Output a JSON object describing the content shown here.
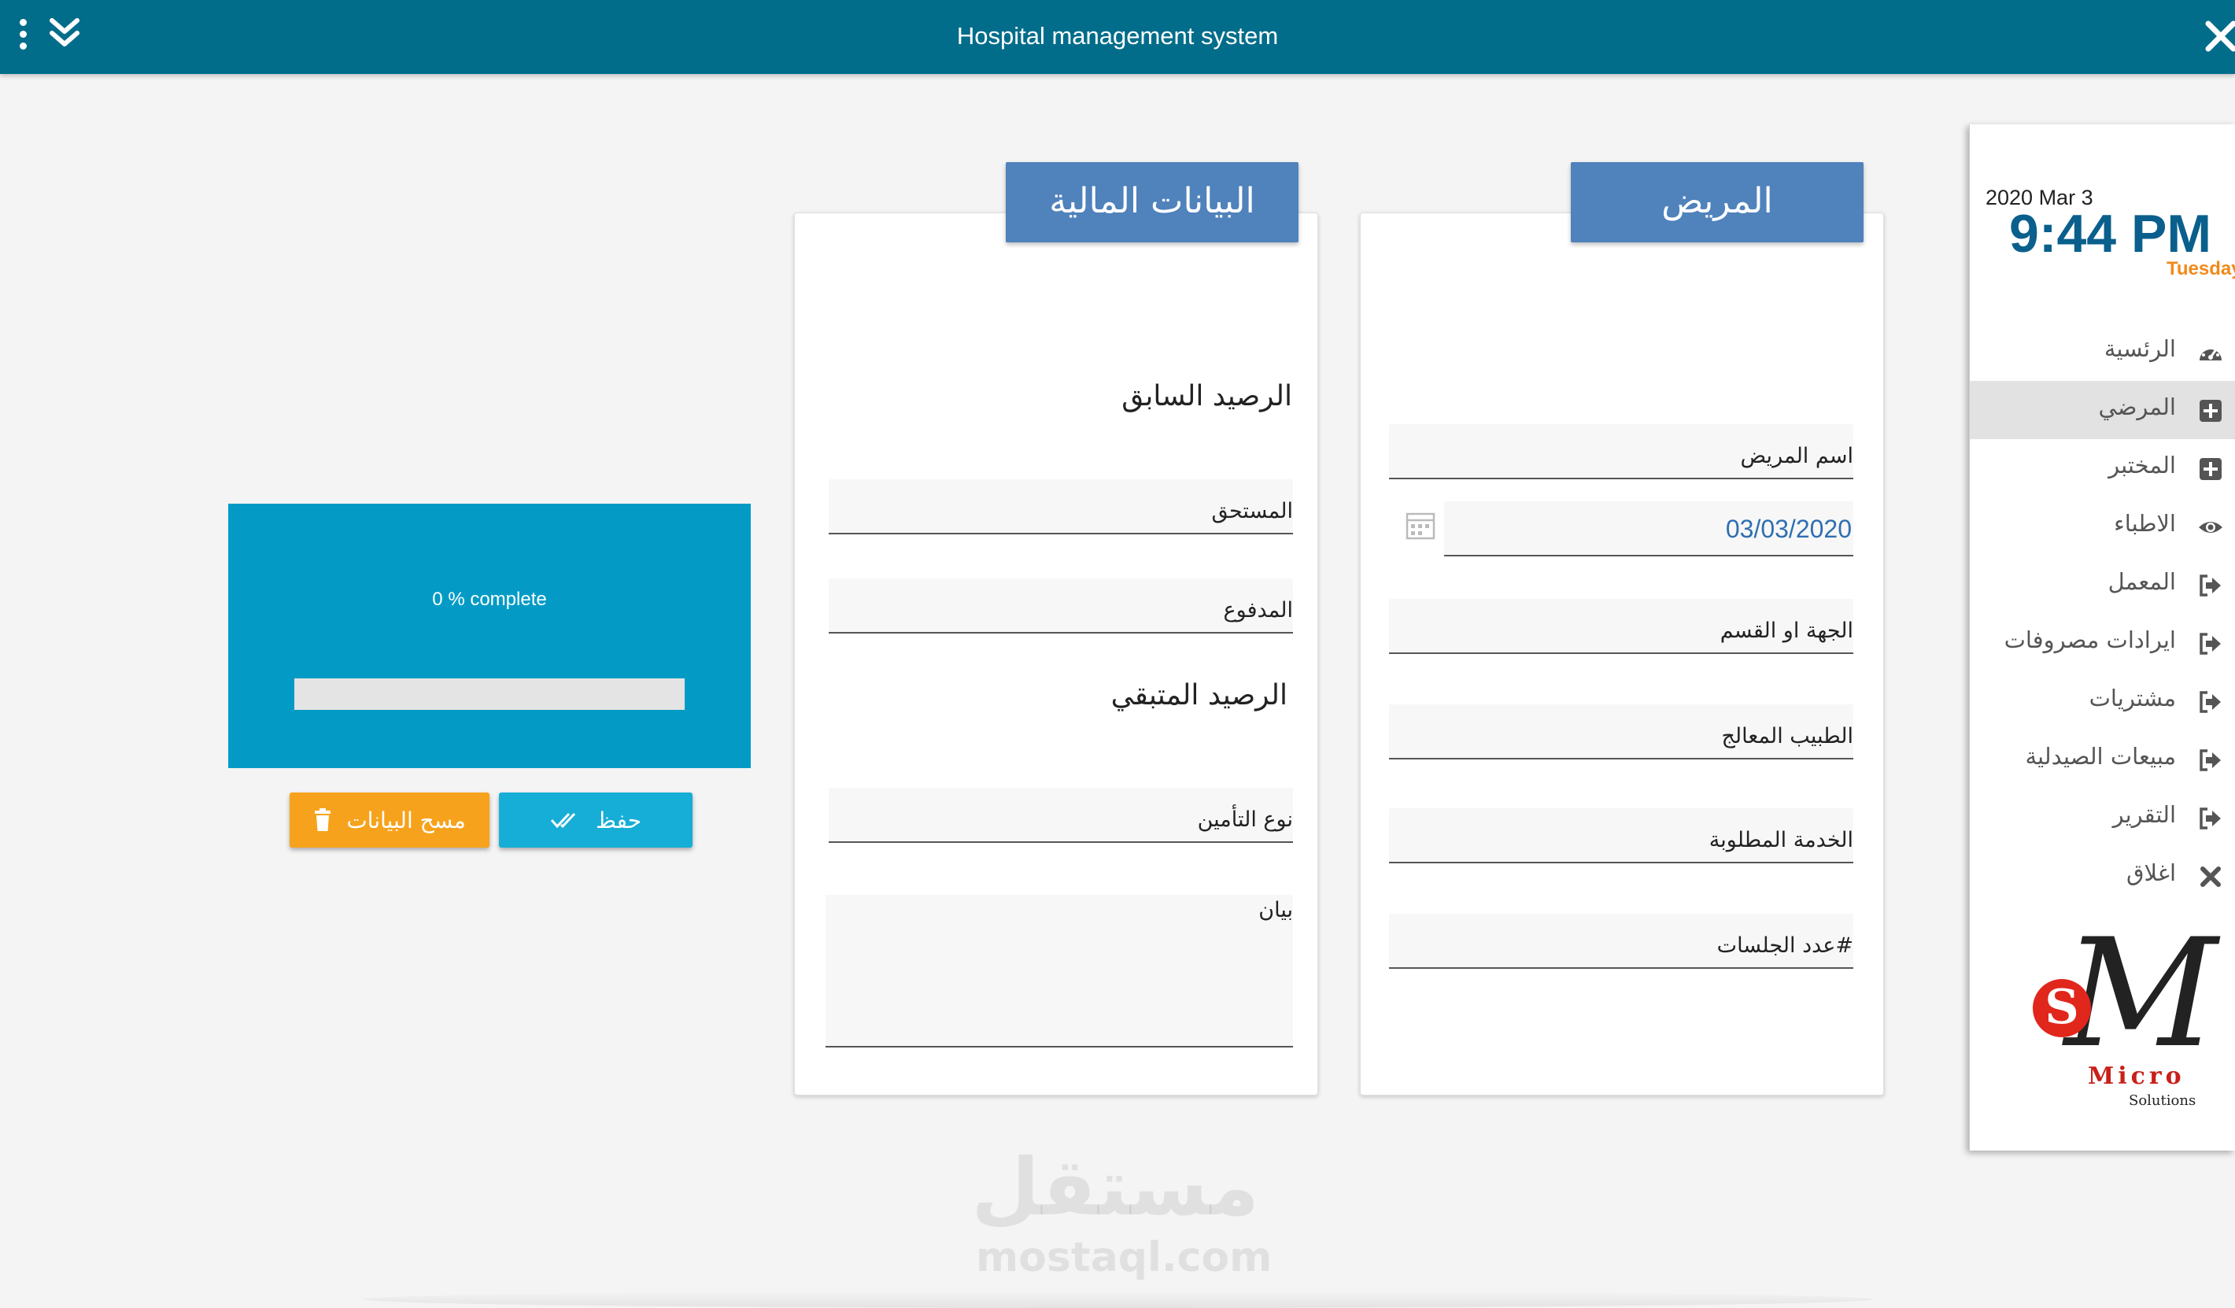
{
  "window": {
    "title": "Hospital management system"
  },
  "patient_card": {
    "header": "المريض",
    "fields": {
      "patient_name": "اسم المريض",
      "date_value": "03/03/2020",
      "department": "الجهة او القسم",
      "doctor": "الطبيب المعالج",
      "service": "الخدمة المطلوبة",
      "sessions": "#عدد الجلسات"
    }
  },
  "finance_card": {
    "header": "البيانات المالية",
    "previous_balance": "الرصيد السابق",
    "fields": {
      "due": "المستحق",
      "paid": "المدفوع",
      "insurance_type": "نوع التأمين",
      "statement": "بيان"
    },
    "remaining_balance": "الرصيد المتبقي"
  },
  "progress": {
    "text": "0 % complete",
    "percent": 0,
    "fill_color": "#5cb85c"
  },
  "buttons": {
    "save": "حفظ",
    "clear": "مسح البيانات"
  },
  "sidebar": {
    "date": "2020 Mar 3",
    "time": "9:44 PM",
    "day": "Tuesday",
    "menu": [
      {
        "label": "الرئسية",
        "icon": "dashboard-icon"
      },
      {
        "label": "المرضي",
        "icon": "plus-square-icon"
      },
      {
        "label": "المختبر",
        "icon": "plus-square-icon"
      },
      {
        "label": "الاطباء",
        "icon": "eye-icon"
      },
      {
        "label": "المعمل",
        "icon": "sign-out-icon"
      },
      {
        "label": "ايرادات مصروفات",
        "icon": "sign-out-icon"
      },
      {
        "label": "مشتريات",
        "icon": "sign-out-icon"
      },
      {
        "label": "مبيعات الصيدلية",
        "icon": "sign-out-icon"
      },
      {
        "label": "التقرير",
        "icon": "sign-out-icon"
      },
      {
        "label": "اغلاق",
        "icon": "close-icon"
      }
    ],
    "active_index": 1,
    "logo": {
      "letter_m": "M",
      "letter_s": "S",
      "micro": "Micro",
      "solutions": "Solutions"
    }
  },
  "watermark": {
    "arabic": "مستقل",
    "latin": "mostaql.com"
  },
  "colors": {
    "titlebar": "#016d8b",
    "card_header": "#5082bc",
    "progress_panel": "#039bc6",
    "save_button": "#16aed6",
    "clear_button": "#f7a21c",
    "clock": "#0a5f8c",
    "day": "#f08a1a"
  }
}
